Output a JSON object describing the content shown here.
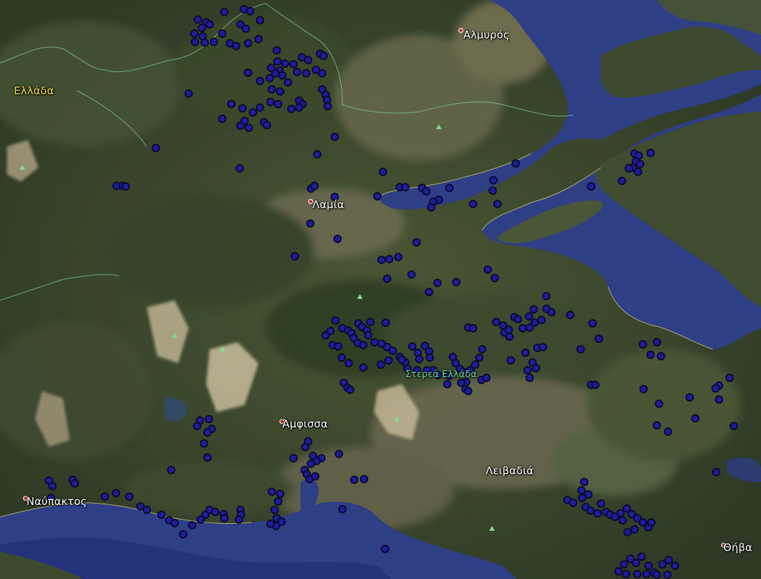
{
  "map": {
    "colors": {
      "sea": "#2e3f86",
      "sea_deep": "#1a2560",
      "land": "#3d4a30",
      "mountain": "#b8ab8c",
      "coast_line": "#d8d070",
      "border_line": "#7fd4b4",
      "marker_fill": "#1e1e9c",
      "marker_ring": "#0a0a30",
      "city_label": "#ffffff",
      "country_label": "#f2e24a",
      "admin_label": "#6fe0a8"
    },
    "labels": {
      "almyros": "Αλμυρός",
      "ellada": "Ελλάδα",
      "lamia": "Λαμία",
      "amfissa": "Άμφισσα",
      "nafpaktos": "Ναύπακτος",
      "livadia": "Λειβαδιά",
      "thiva": "Θήβα",
      "sterea": "Στερεά Ελλάδα"
    },
    "marker_icon": "blue-circle-marker-icon",
    "peak_icon": "green-triangle-peak-icon"
  }
}
